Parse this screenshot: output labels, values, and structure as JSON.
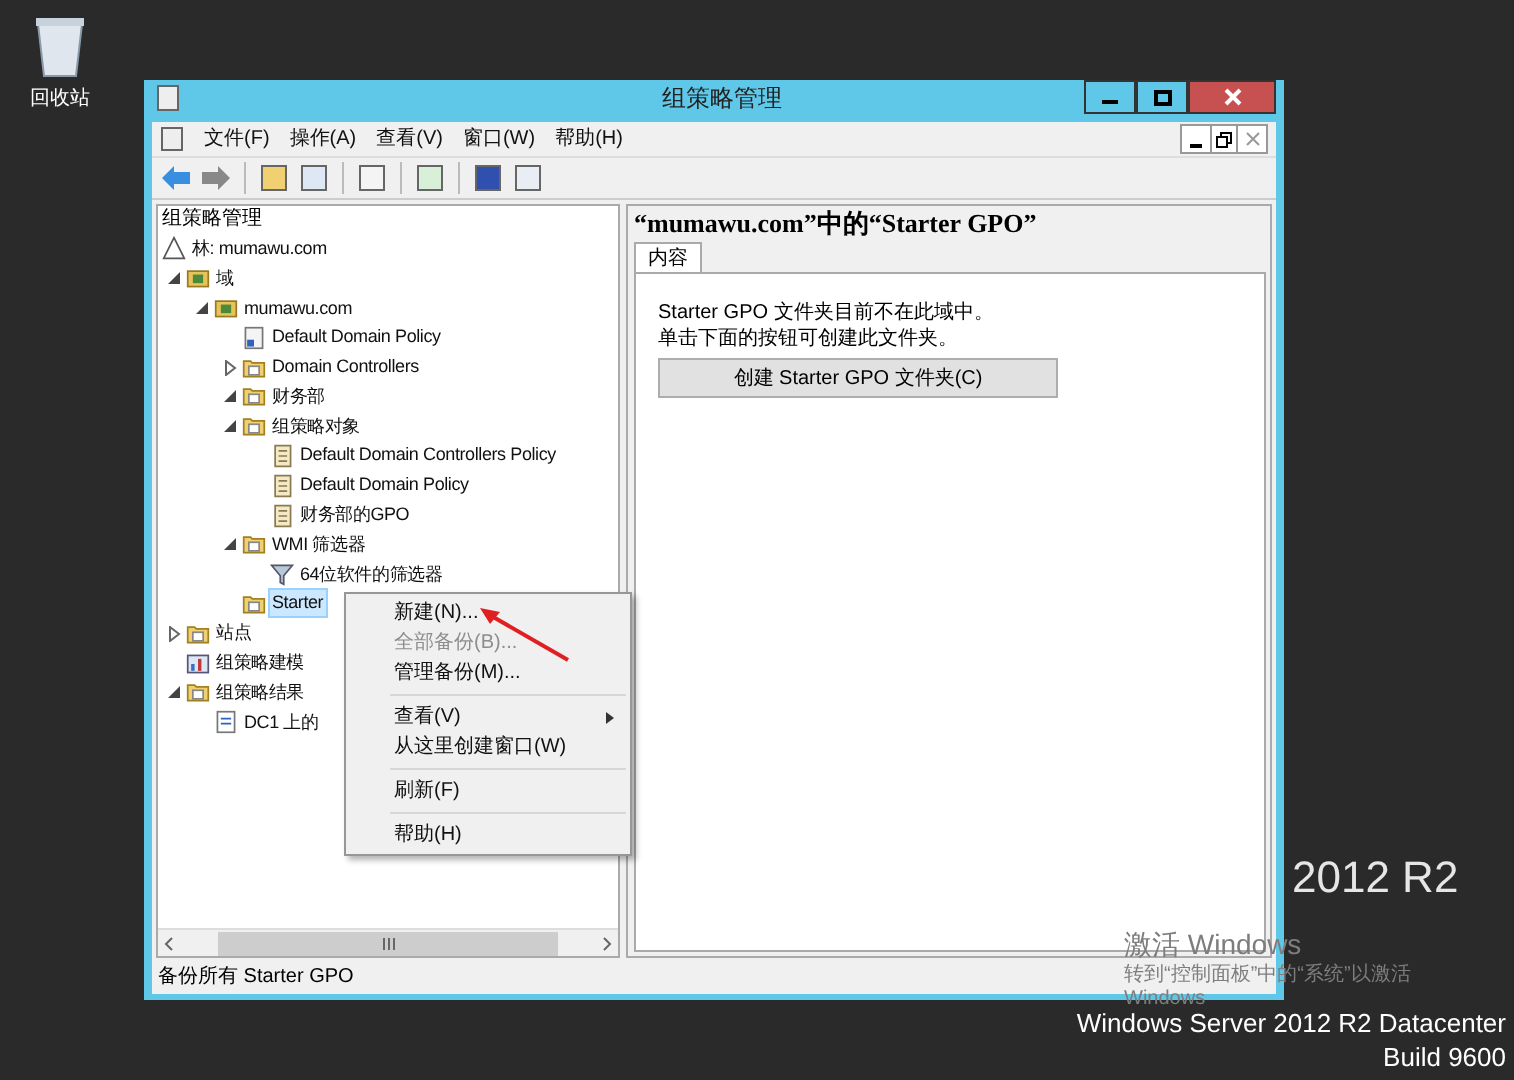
{
  "desktop": {
    "recycle_bin_label": "回收站",
    "os_brand": "2012 R2",
    "activation_title": "激活 Windows",
    "activation_text": "转到“控制面板”中的“系统”以激活",
    "activation_text_2": "Windows",
    "os_edition": "Windows Server 2012 R2 Datacenter",
    "build": "Build 9600"
  },
  "window": {
    "title": "组策略管理",
    "menu": [
      "文件(F)",
      "操作(A)",
      "查看(V)",
      "窗口(W)",
      "帮助(H)"
    ],
    "tree_header": "组策略管理",
    "tree": [
      {
        "kind": "forest",
        "label": "林: mumawu.com",
        "selected": false,
        "children": [
          {
            "kind": "domains",
            "label": "域",
            "expanded": true,
            "selected": false,
            "children": [
              {
                "kind": "domain",
                "label": "mumawu.com",
                "expanded": true,
                "selected": false,
                "children": [
                  {
                    "kind": "gpo-link",
                    "label": "Default Domain Policy",
                    "selected": false
                  },
                  {
                    "kind": "ou",
                    "label": "Domain Controllers",
                    "expanded": false,
                    "selected": false
                  },
                  {
                    "kind": "ou",
                    "label": "财务部",
                    "expanded": true,
                    "selected": false
                  },
                  {
                    "kind": "gpo-folder",
                    "label": "组策略对象",
                    "expanded": true,
                    "selected": false,
                    "children": [
                      {
                        "kind": "gpo",
                        "label": "Default Domain Controllers Policy",
                        "selected": false
                      },
                      {
                        "kind": "gpo",
                        "label": "Default Domain Policy",
                        "selected": false
                      },
                      {
                        "kind": "gpo",
                        "label": "财务部的GPO",
                        "selected": false
                      }
                    ]
                  },
                  {
                    "kind": "wmi-folder",
                    "label": "WMI 筛选器",
                    "expanded": true,
                    "selected": false,
                    "children": [
                      {
                        "kind": "wmi",
                        "label": "64位软件的筛选器",
                        "selected": false
                      }
                    ]
                  },
                  {
                    "kind": "starter",
                    "label": "Starter",
                    "selected": true
                  }
                ]
              }
            ]
          },
          {
            "kind": "sites",
            "label": "站点",
            "expanded": false,
            "selected": false
          },
          {
            "kind": "modeling",
            "label": "组策略建模",
            "selected": false
          },
          {
            "kind": "results",
            "label": "组策略结果",
            "expanded": true,
            "selected": false,
            "children": [
              {
                "kind": "result",
                "label": "DC1 上的",
                "selected": false
              }
            ]
          }
        ]
      }
    ],
    "heading": "“mumawu.com”中的“Starter GPO”",
    "tabs": [
      {
        "label": "内容",
        "selected": true
      }
    ],
    "message": [
      "Starter GPO 文件夹目前不在此域中。",
      "单击下面的按钮可创建此文件夹。"
    ],
    "create_button": "创建 Starter GPO 文件夹(C)",
    "status_bar": "备份所有 Starter GPO"
  },
  "context_menu": [
    {
      "kind": "item",
      "label": "新建(N)...",
      "disabled": false,
      "submenu": false
    },
    {
      "kind": "item",
      "label": "全部备份(B)...",
      "disabled": true,
      "submenu": false
    },
    {
      "kind": "item",
      "label": "管理备份(M)...",
      "disabled": false,
      "submenu": false
    },
    {
      "kind": "separator"
    },
    {
      "kind": "item",
      "label": "查看(V)",
      "disabled": false,
      "submenu": true
    },
    {
      "kind": "item",
      "label": "从这里创建窗口(W)",
      "disabled": false,
      "submenu": false
    },
    {
      "kind": "separator"
    },
    {
      "kind": "item",
      "label": "刷新(F)",
      "disabled": false,
      "submenu": false
    },
    {
      "kind": "separator"
    },
    {
      "kind": "item",
      "label": "帮助(H)",
      "disabled": false,
      "submenu": false
    }
  ]
}
